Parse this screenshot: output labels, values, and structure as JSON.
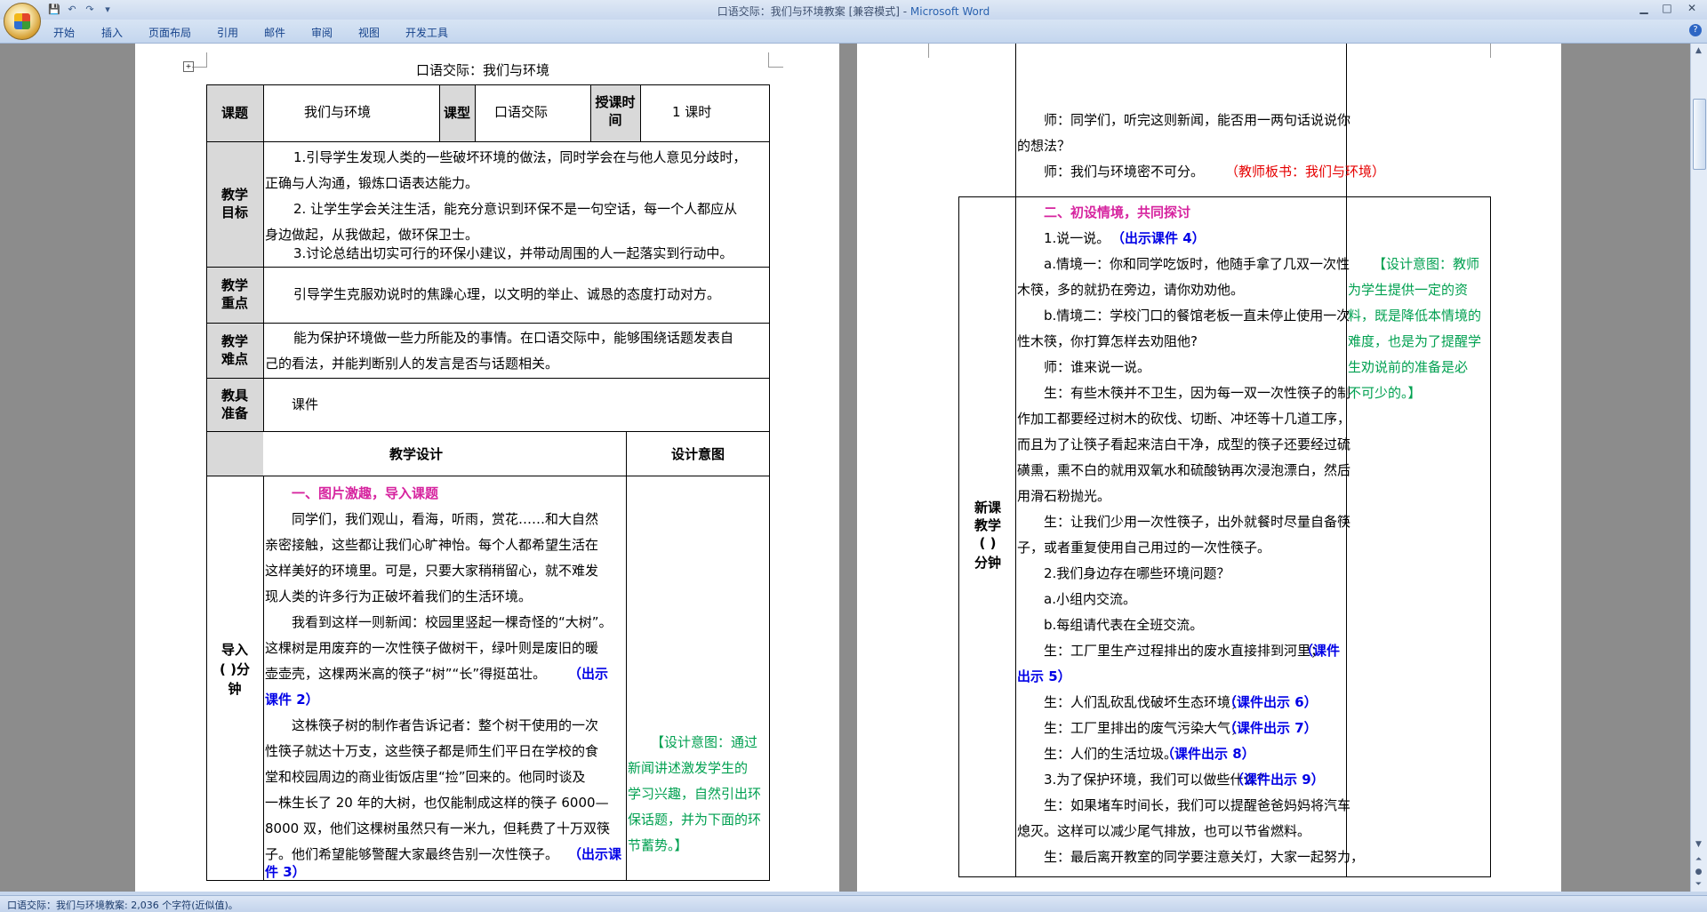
{
  "window": {
    "title_prefix": "口语交际：我们与环境教案 [兼容模式] - ",
    "title_app": "Microsoft Word",
    "minimize": "▁",
    "maximize": "□",
    "close": "✕"
  },
  "qat": {
    "save": "💾",
    "undo": "↶",
    "redo": "↷",
    "more": "▾"
  },
  "ribbon_tabs": [
    "开始",
    "插入",
    "页面布局",
    "引用",
    "邮件",
    "审阅",
    "视图",
    "开发工具"
  ],
  "help": "?",
  "status": "口语交际：我们与环境教案: 2,036 个字符(近似值)。",
  "page1": {
    "doc_title": "口语交际：我们与环境",
    "row1": {
      "h1": "课题",
      "v1": "我们与环境",
      "h2": "课型",
      "v2": "口语交际",
      "h3": "授课时间",
      "v3": "1 课时"
    },
    "goals_label": "教学目标",
    "goals": [
      "1.引导学生发现人类的一些破坏环境的做法，同时学会在与他人意见分歧时，",
      "正确与人沟通，锻炼口语表达能力。",
      "2. 让学生学会关注生活，能充分意识到环保不是一句空话，每一个人都应从",
      "身边做起，从我做起，做环保卫士。",
      "3.讨论总结出切实可行的环保小建议，并带动周围的人一起落实到行动中。"
    ],
    "key_label": "教学重点",
    "key": "引导学生克服劝说时的焦躁心理，以文明的举止、诚恳的态度打动对方。",
    "diff_label": "教学难点",
    "diff": [
      "能为保护环境做一些力所能及的事情。在口语交际中，能够围绕话题发表自",
      "己的看法，并能判断别人的发言是否与话题相关。"
    ],
    "tools_label": "教具准备",
    "tools": "课件",
    "design_head": "教学设计",
    "intent_head": "设计意图",
    "intro_label": [
      "导入",
      "(    )分",
      "钟"
    ],
    "section1": "一、图片激趣，导入课题",
    "body": [
      "同学们，我们观山，看海，听雨，赏花……和大自然",
      "亲密接触，这些都让我们心旷神怡。每个人都希望生活在",
      "这样美好的环境里。可是，只要大家稍稍留心，就不难发",
      "现人类的许多行为正破坏着我们的生活环境。",
      "我看到这样一则新闻：校园里竖起一棵奇怪的“大树”。",
      "这棵树是用废弃的一次性筷子做树干，绿叶则是废旧的暖",
      "壶壶壳，这棵两米高的筷子“树”“长”得挺茁壮。",
      "（出示",
      "课件 2）",
      "这株筷子树的制作者告诉记者：整个树干使用的一次",
      "性筷子就达十万支，这些筷子都是师生们平日在学校的食",
      "堂和校园周边的商业街饭店里“捡”回来的。他同时谈及",
      "一株生长了 20 年的大树，也仅能制成这样的筷子 6000—",
      "8000 双，他们这棵树虽然只有一米九，但耗费了十万双筷",
      "子。他们希望能够警醒大家最终告别一次性筷子。",
      "（出示课",
      "件 3）"
    ],
    "intent": [
      "【设计意图：通过",
      "新闻讲述激发学生的",
      "学习兴趣，自然引出环",
      "保话题，并为下面的环",
      "节蓄势。】"
    ]
  },
  "page2": {
    "top": [
      "师：同学们，听完这则新闻，能否用一两句话说说你",
      "的想法？",
      "师：我们与环境密不可分。",
      "（教师板书：我们与环境）"
    ],
    "new_label": [
      "新课",
      "教学",
      "(      )",
      "分钟"
    ],
    "section2": "二、初设情境，共同探讨",
    "lines": [
      "1.说一说。",
      "（出示课件 4）",
      "a.情境一：你和同学吃饭时，他随手拿了几双一次性",
      "木筷，多的就扔在旁边，请你劝劝他。",
      "b.情境二：学校门口的餐馆老板一直未停止使用一次",
      "性木筷，你打算怎样去劝阻他?",
      "师：谁来说一说。",
      "生：有些木筷并不卫生，因为每一双一次性筷子的制",
      "作加工都要经过树木的砍伐、切断、冲坯等十几道工序，",
      "而且为了让筷子看起来洁白干净，成型的筷子还要经过硫",
      "磺熏，熏不白的就用双氧水和硫酸钠再次浸泡漂白，然后",
      "用滑石粉抛光。",
      "生：让我们少用一次性筷子，出外就餐时尽量自备筷",
      "子，或者重复使用自己用过的一次性筷子。",
      "2.我们身边存在哪些环境问题？",
      "a.小组内交流。",
      "b.每组请代表在全班交流。",
      "生：工厂里生产过程排出的废水直接排到河里；",
      "（课件",
      "出示 5）",
      "生：人们乱砍乱伐破坏生态环境；",
      "（课件出示 6）",
      "生：工厂里排出的废气污染大气；",
      "（课件出示 7）",
      "生：人们的生活垃圾。",
      "（课件出示 8）",
      "3.为了保护环境，我们可以做些什么？",
      "（课件出示 9）",
      "生：如果堵车时间长，我们可以提醒爸爸妈妈将汽车",
      "熄灭。这样可以减少尾气排放，也可以节省燃料。",
      "生：最后离开教室的同学要注意关灯，大家一起努力，"
    ],
    "intent": [
      "【设计意图：教师",
      "为学生提供一定的资",
      "料，既是降低本情境的",
      "难度，也是为了提醒学",
      "生劝说前的准备是必",
      "不可少的。】"
    ]
  }
}
